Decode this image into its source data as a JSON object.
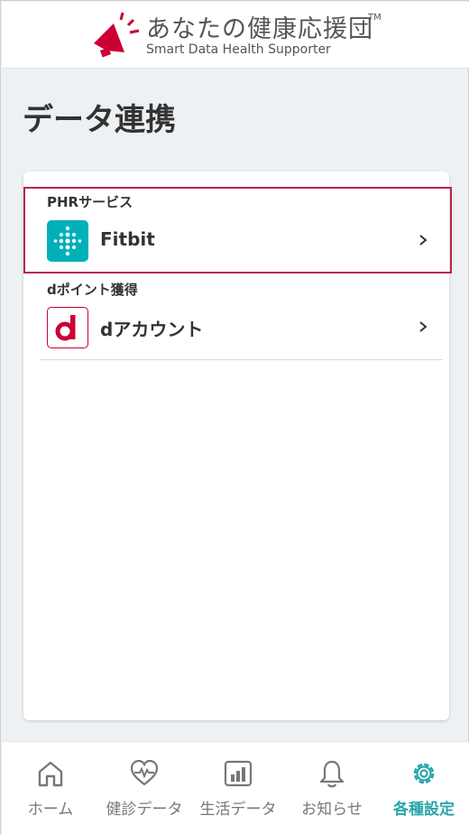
{
  "header": {
    "logo_title": "あなたの健康応援団",
    "logo_tm": "TM",
    "logo_subtitle": "Smart Data Health Supporter"
  },
  "page": {
    "title": "データ連携"
  },
  "sections": [
    {
      "label": "PHRサービス",
      "items": [
        {
          "label": "Fitbit",
          "icon": "fitbit-icon"
        }
      ]
    },
    {
      "label": "dポイント獲得",
      "items": [
        {
          "label": "dアカウント",
          "icon": "d-account-icon"
        }
      ]
    }
  ],
  "bottom_nav": [
    {
      "label": "ホーム",
      "icon": "home-icon",
      "active": false
    },
    {
      "label": "健診データ",
      "icon": "heart-pulse-icon",
      "active": false
    },
    {
      "label": "生活データ",
      "icon": "bar-chart-icon",
      "active": false
    },
    {
      "label": "お知らせ",
      "icon": "bell-icon",
      "active": false
    },
    {
      "label": "各種設定",
      "icon": "gear-icon",
      "active": true
    }
  ],
  "colors": {
    "accent": "#2aa7a9",
    "highlight": "#b8244e",
    "docomo_red": "#cc0033",
    "fitbit_teal": "#00b0b9"
  }
}
